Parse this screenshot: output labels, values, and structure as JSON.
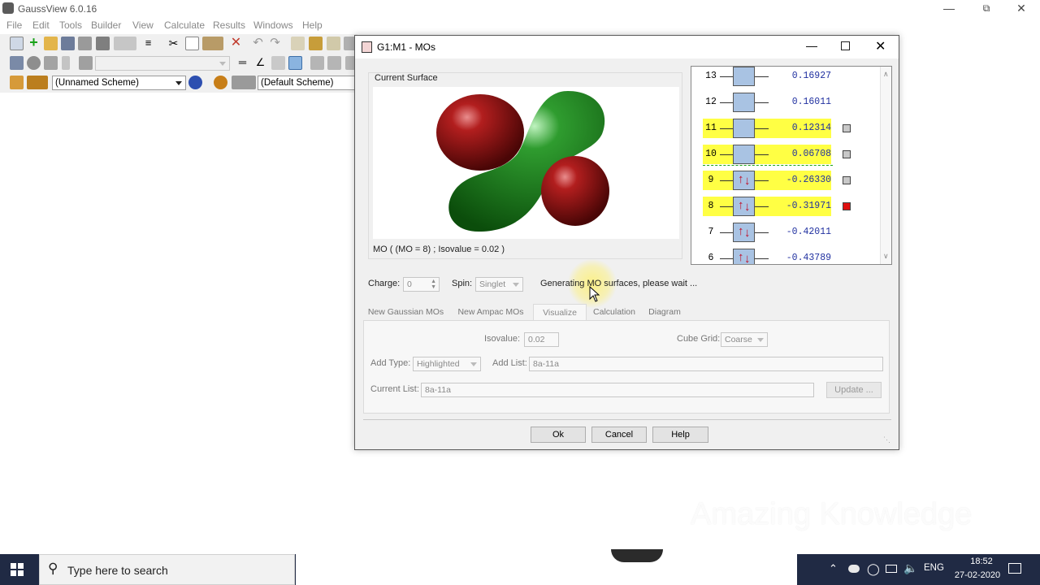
{
  "app": {
    "title": "GaussView 6.0.16"
  },
  "menus": [
    "File",
    "Edit",
    "Tools",
    "Builder",
    "View",
    "Calculate",
    "Results",
    "Windows",
    "Help"
  ],
  "toolbar": {
    "scheme1": "(Unnamed Scheme)",
    "scheme2": "(Default Scheme)"
  },
  "dialog": {
    "title": "G1:M1 - MOs",
    "surface_group": "Current Surface",
    "surface_caption": "MO ( (MO = 8) ; Isovalue = 0.02 )",
    "charge_label": "Charge:",
    "charge_value": "0",
    "spin_label": "Spin:",
    "spin_value": "Singlet",
    "status": "Generating MO surfaces, please wait ...",
    "mo_list": [
      {
        "n": "13",
        "energy": "0.16927",
        "highlight": false,
        "occupied": false,
        "check": "none"
      },
      {
        "n": "12",
        "energy": "0.16011",
        "highlight": false,
        "occupied": false,
        "check": "none"
      },
      {
        "n": "11",
        "energy": "0.12314",
        "highlight": true,
        "occupied": false,
        "check": "gray"
      },
      {
        "n": "10",
        "energy": "0.06708",
        "highlight": true,
        "occupied": false,
        "check": "gray"
      },
      {
        "n": "9",
        "energy": "-0.26330",
        "highlight": true,
        "occupied": true,
        "check": "gray"
      },
      {
        "n": "8",
        "energy": "-0.31971",
        "highlight": true,
        "occupied": true,
        "check": "red"
      },
      {
        "n": "7",
        "energy": "-0.42011",
        "highlight": false,
        "occupied": true,
        "check": "none"
      },
      {
        "n": "6",
        "energy": "-0.43789",
        "highlight": false,
        "occupied": true,
        "check": "none"
      }
    ],
    "tabs": [
      "New Gaussian MOs",
      "New Ampac MOs",
      "Visualize",
      "Calculation",
      "Diagram"
    ],
    "active_tab": "Visualize",
    "isovalue_label": "Isovalue:",
    "isovalue_value": "0.02",
    "cubegrid_label": "Cube Grid:",
    "cubegrid_value": "Coarse",
    "addtype_label": "Add Type:",
    "addtype_value": "Highlighted",
    "addlist_label": "Add List:",
    "addlist_value": "8a-11a",
    "currentlist_label": "Current List:",
    "currentlist_value": "8a-11a",
    "update_btn": "Update ...",
    "ok": "Ok",
    "cancel": "Cancel",
    "help": "Help"
  },
  "taskbar": {
    "search_placeholder": "Type here to search",
    "lang": "ENG",
    "time": "18:52",
    "date": "27-02-2020"
  },
  "watermark": "Amazing Knowledge",
  "colors": {
    "highlight": "#ffff44",
    "mo_box": "#a9c3e3",
    "lobe_red": "#8b0d0d",
    "lobe_green": "#1f8a1f",
    "taskbar": "#202a44"
  }
}
